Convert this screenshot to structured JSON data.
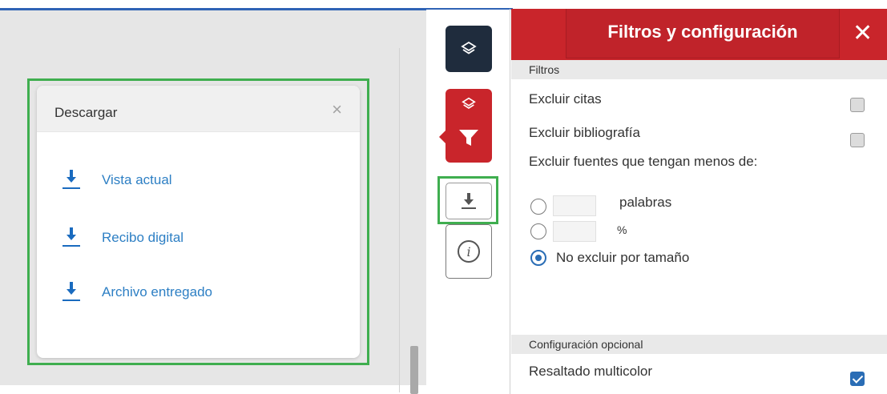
{
  "download_dialog": {
    "title": "Descargar",
    "close_glyph": "×",
    "items": [
      {
        "label": "Vista actual",
        "icon": "download-icon"
      },
      {
        "label": "Recibo digital",
        "icon": "download-icon"
      },
      {
        "label": "Archivo entregado",
        "icon": "download-icon"
      }
    ]
  },
  "toolbar": {
    "items": [
      {
        "name": "layers",
        "icon": "layers-icon"
      },
      {
        "name": "filter",
        "icon": "filter-icon"
      },
      {
        "name": "download",
        "icon": "download-icon"
      },
      {
        "name": "info",
        "icon": "info-icon",
        "glyph": "i"
      }
    ]
  },
  "panel": {
    "title": "Filtros y configuración",
    "close_glyph": "✕",
    "filters": {
      "section_label": "Filtros",
      "exclude_quotes": {
        "label": "Excluir citas",
        "checked": false
      },
      "exclude_bibliography": {
        "label": "Excluir bibliografía",
        "checked": false
      },
      "exclude_sources_label": "Excluir fuentes que tengan menos de:",
      "words_option": {
        "unit": "palabras",
        "value": "",
        "selected": false
      },
      "percent_option": {
        "unit": "%",
        "value": "",
        "selected": false
      },
      "no_exclude_option": {
        "label": "No excluir por tamaño",
        "selected": true
      }
    },
    "optional": {
      "section_label": "Configuración opcional",
      "multicolor_highlight": {
        "label": "Resaltado multicolor",
        "checked": true
      }
    }
  },
  "colors": {
    "brand_red": "#c9252b",
    "dark_navy": "#1f2c3d",
    "link_blue": "#2d7fc4",
    "highlight_green": "#3fae4f",
    "checkbox_blue": "#2a6db5"
  }
}
